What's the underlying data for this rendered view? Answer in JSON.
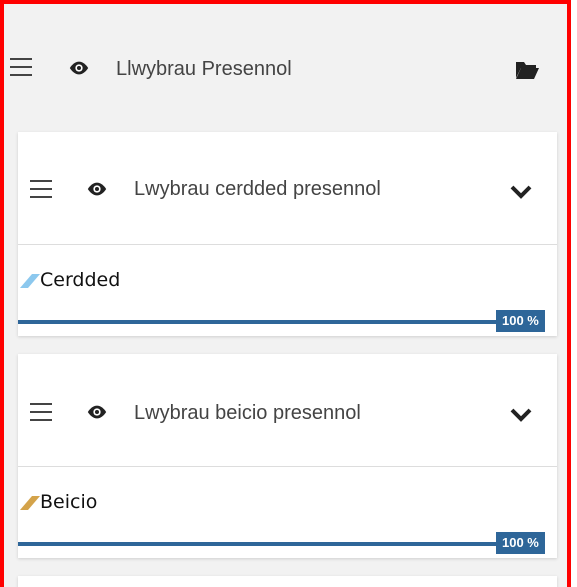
{
  "group": {
    "title": "Llwybrau Presennol",
    "icons": [
      "hamburger-icon",
      "eye-icon",
      "folder-open-icon"
    ]
  },
  "layers": [
    {
      "title": "Lwybrau cerdded presennol",
      "legend_label": "Cerdded",
      "legend_color": "#8cc8ee",
      "opacity_label": "100 %",
      "opacity_value": 1.0
    },
    {
      "title": "Lwybrau beicio presennol",
      "legend_label": "Beicio",
      "legend_color": "#d4a34a",
      "opacity_label": "100 %",
      "opacity_value": 1.0
    }
  ],
  "colors": {
    "frame_border": "#ff0000",
    "slider": "#2e6699"
  }
}
